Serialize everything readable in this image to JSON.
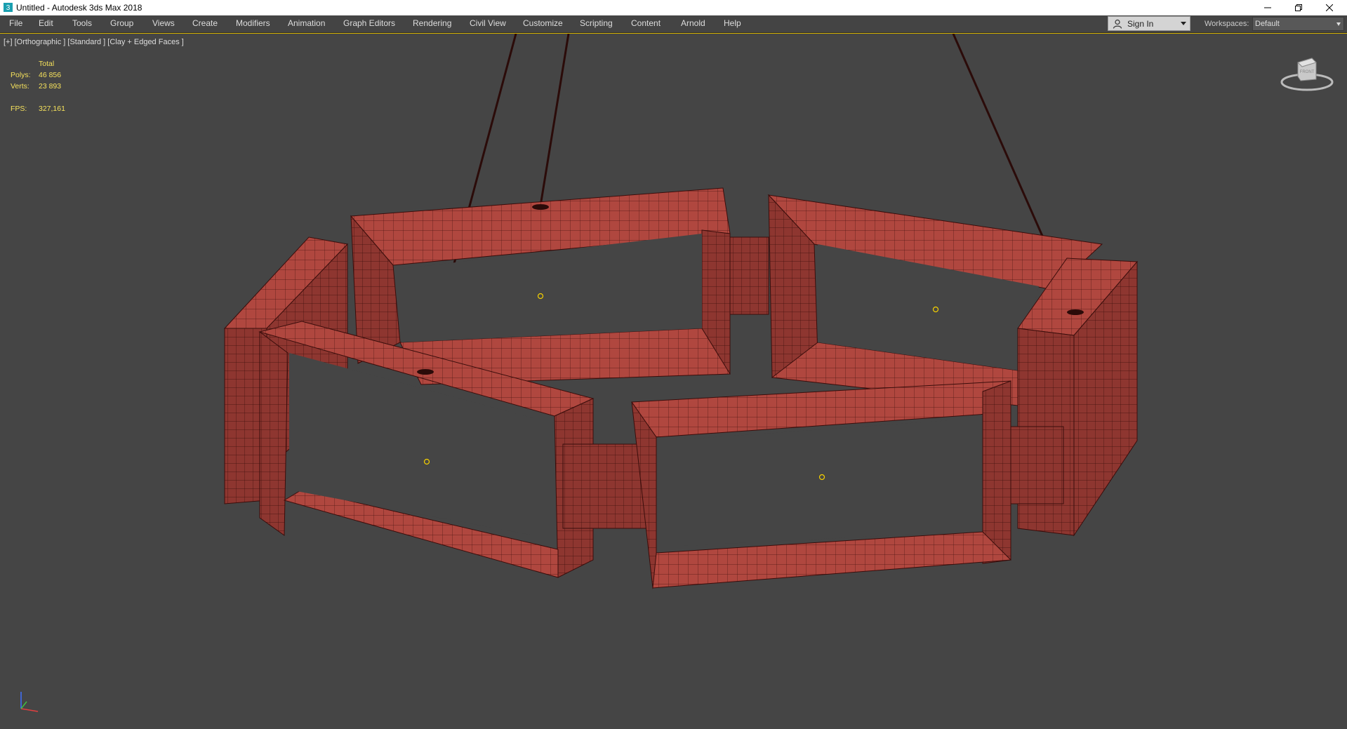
{
  "window": {
    "title": "Untitled - Autodesk 3ds Max 2018",
    "controls": [
      "minimize-icon",
      "restore-icon",
      "close-icon"
    ]
  },
  "menu": [
    "File",
    "Edit",
    "Tools",
    "Group",
    "Views",
    "Create",
    "Modifiers",
    "Animation",
    "Graph Editors",
    "Rendering",
    "Civil View",
    "Customize",
    "Scripting",
    "Content",
    "Arnold",
    "Help"
  ],
  "account": {
    "sign_in": "Sign In"
  },
  "workspace": {
    "label": "Workspaces:",
    "value": "Default"
  },
  "viewport": {
    "label": "[+] [Orthographic ] [Standard ] [Clay + Edged Faces ]",
    "stats": {
      "total_label": "Total",
      "polys_label": "Polys:",
      "polys_value": "46 856",
      "verts_label": "Verts:",
      "verts_value": "23 893",
      "fps_label": "FPS:",
      "fps_value": "327,161"
    },
    "viewcube_label": "FRONT"
  },
  "colors": {
    "viewport_bg": "#454545",
    "model_fill": "#b0473f",
    "wire": "#3a0d0b",
    "stats_text": "#f5e15c",
    "active_border": "#d6b300"
  }
}
